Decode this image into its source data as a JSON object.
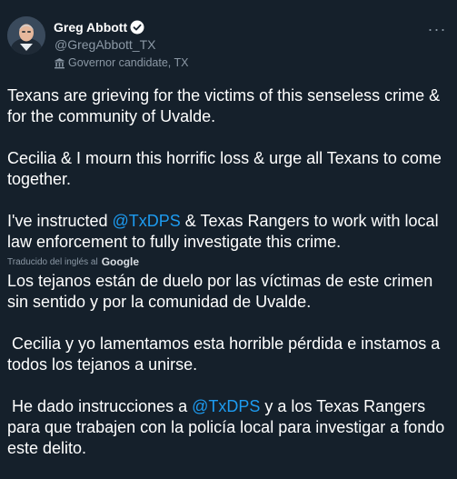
{
  "author": {
    "display_name": "Greg Abbott",
    "handle": "@GregAbbott_TX",
    "label": "Governor candidate, TX",
    "verified_icon": "verified-badge-icon",
    "label_icon": "government-building-icon",
    "more_icon": "more-horizontal-icon"
  },
  "tweet": {
    "original": {
      "p1": "Texans are grieving for the victims of this senseless crime & for the community of Uvalde.",
      "p2": "Cecilia & I mourn this horrific loss & urge all Texans to come together.",
      "p3_before": "I've instructed ",
      "p3_mention": "@TxDPS",
      "p3_after": " & Texas Rangers to work with local law enforcement to fully investigate this crime."
    },
    "translation_label": "Traducido del inglés al",
    "translation_provider": "Google",
    "translated": {
      "p1": "Los tejanos están de duelo por las víctimas de este crimen sin sentido y por la comunidad de Uvalde.",
      "p2": " Cecilia y yo lamentamos esta horrible pérdida e instamos a todos los tejanos a unirse.",
      "p3_before": " He dado instrucciones a ",
      "p3_mention": "@TxDPS",
      "p3_after": " y a los Texas Rangers para que trabajen con la policía local para investigar a fondo este delito."
    }
  },
  "colors": {
    "background": "#15202b",
    "text": "#ffffff",
    "secondary": "#8b98a5",
    "accent": "#1d9bf0"
  }
}
